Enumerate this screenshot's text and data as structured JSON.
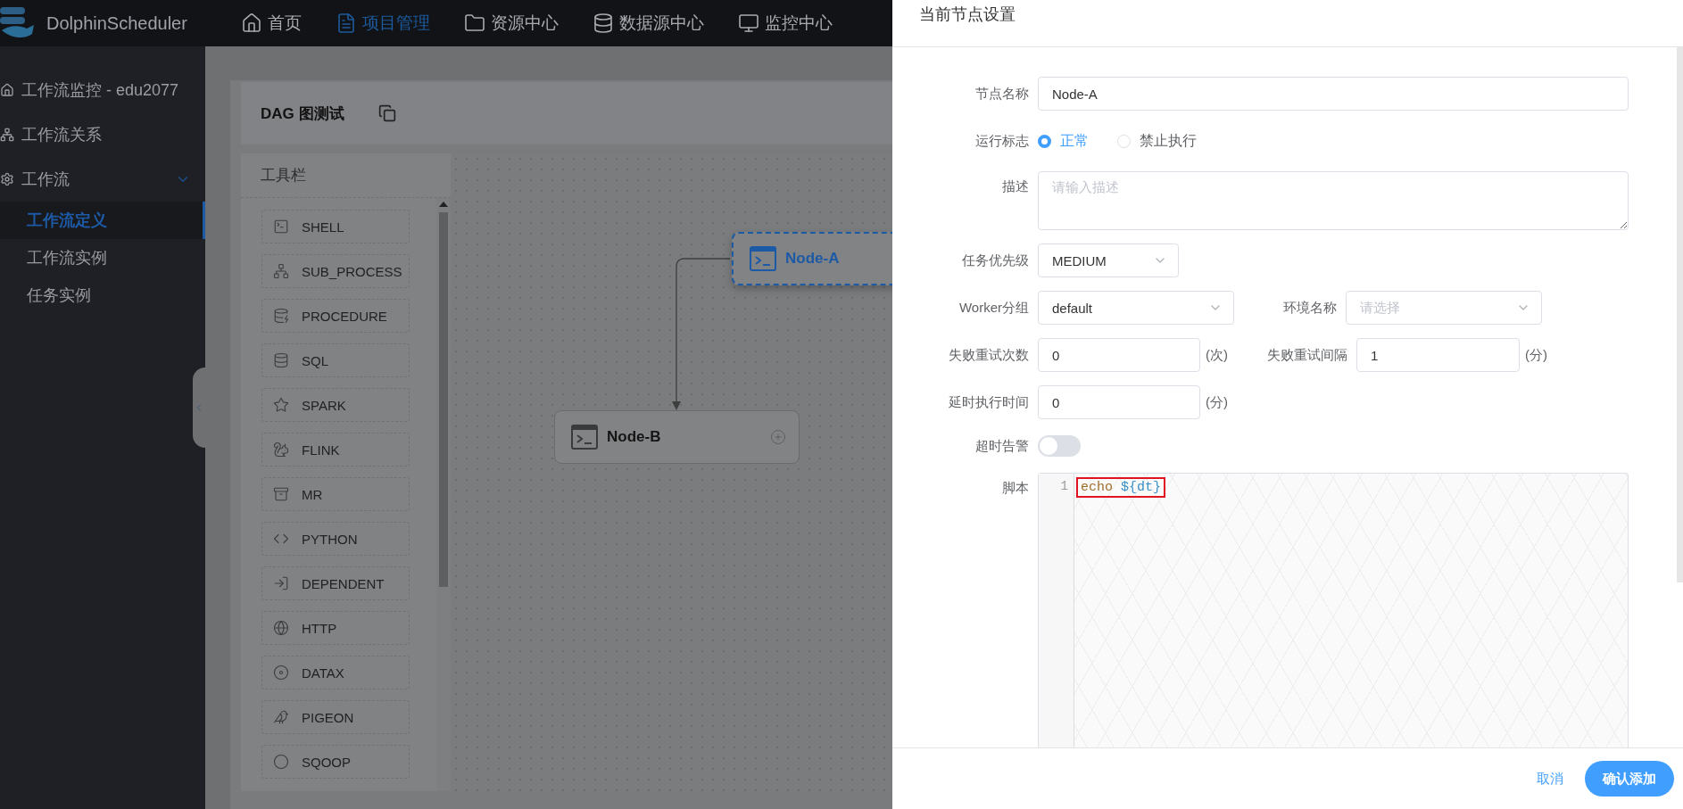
{
  "app": {
    "logo": "DolphinScheduler"
  },
  "nav": [
    {
      "label": "首页",
      "selected": false
    },
    {
      "label": "项目管理",
      "selected": true
    },
    {
      "label": "资源中心",
      "selected": false
    },
    {
      "label": "数据源中心",
      "selected": false
    },
    {
      "label": "监控中心",
      "selected": false
    }
  ],
  "sidebar": {
    "items": [
      {
        "label": "工作流监控 - edu2077",
        "selected": false
      },
      {
        "label": "工作流关系",
        "selected": false
      },
      {
        "label": "工作流",
        "selected": false,
        "expanded": true,
        "children": [
          {
            "label": "工作流定义",
            "selected": true
          },
          {
            "label": "工作流实例",
            "selected": false
          },
          {
            "label": "任务实例",
            "selected": false
          }
        ]
      }
    ]
  },
  "dag": {
    "title": "DAG 图测试",
    "toolbar": {
      "title": "工具栏",
      "tools": [
        "SHELL",
        "SUB_PROCESS",
        "PROCEDURE",
        "SQL",
        "SPARK",
        "FLINK",
        "MR",
        "PYTHON",
        "DEPENDENT",
        "HTTP",
        "DATAX",
        "PIGEON",
        "SQOOP"
      ]
    },
    "nodes": [
      {
        "name": "Node-A",
        "selected": true
      },
      {
        "name": "Node-B",
        "selected": false
      }
    ]
  },
  "drawer": {
    "title": "当前节点设置",
    "node_name": {
      "label": "节点名称",
      "value": "Node-A"
    },
    "run_flag": {
      "label": "运行标志",
      "options": [
        {
          "label": "正常",
          "selected": true
        },
        {
          "label": "禁止执行",
          "selected": false
        }
      ]
    },
    "description": {
      "label": "描述",
      "placeholder": "请输入描述"
    },
    "priority": {
      "label": "任务优先级",
      "value": "MEDIUM"
    },
    "worker_group": {
      "label": "Worker分组",
      "value": "default"
    },
    "environment": {
      "label": "环境名称",
      "placeholder": "请选择"
    },
    "retry_times": {
      "label": "失败重试次数",
      "value": "0",
      "unit": "(次)"
    },
    "retry_interval": {
      "label": "失败重试间隔",
      "value": "1",
      "unit": "(分)"
    },
    "delay_time": {
      "label": "延时执行时间",
      "value": "0",
      "unit": "(分)"
    },
    "timeout_alert": {
      "label": "超时告警",
      "on": false
    },
    "script": {
      "label": "脚本",
      "highlighted": true,
      "lines": [
        {
          "number": "1",
          "tokens": [
            {
              "text": "echo",
              "kind": "command"
            },
            {
              "text": "${dt}",
              "kind": "variable"
            }
          ]
        }
      ]
    },
    "buttons": [
      {
        "label": "取消",
        "kind": "text"
      },
      {
        "label": "确认添加",
        "kind": "primary"
      }
    ]
  }
}
